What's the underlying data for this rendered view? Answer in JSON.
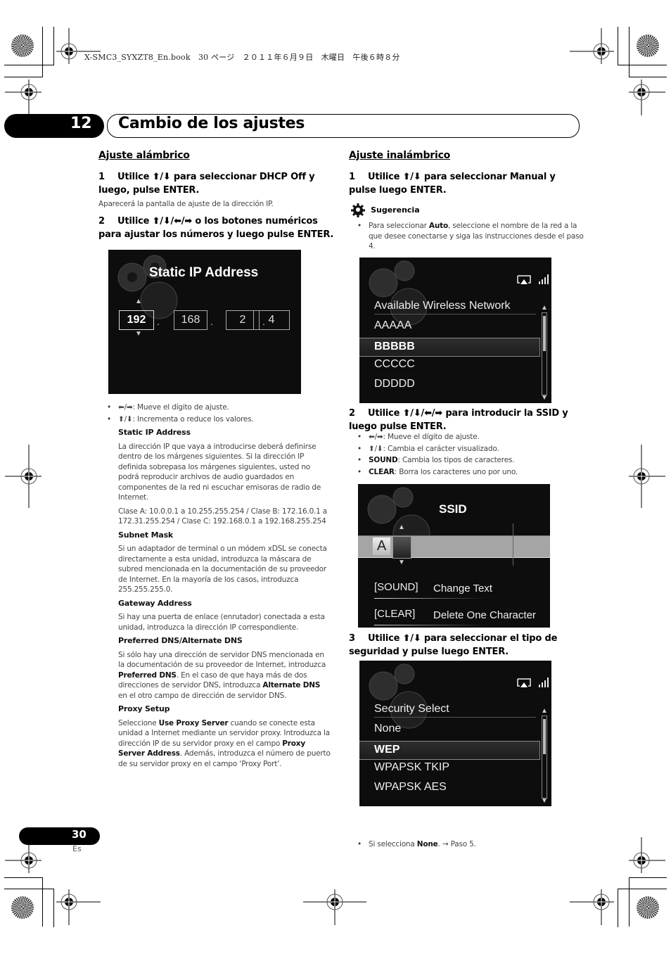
{
  "print_header": "X-SMC3_SYXZT8_En.book　30 ページ　２０１１年６月９日　木曜日　午後６時８分",
  "chapter": {
    "number": "12",
    "title": "Cambio de los ajustes"
  },
  "left": {
    "heading": "Ajuste alámbrico",
    "step1": {
      "num": "1",
      "text": "Utilice ⬆/⬇ para seleccionar DHCP Off y luego, pulse ENTER.",
      "note": "Aparecerá la pantalla de ajuste de la dirección IP."
    },
    "step2": {
      "num": "2",
      "text": "Utilice ⬆/⬇/⬅/➡ o los botones numéricos para ajustar los números y luego pulse ENTER."
    },
    "screen": {
      "title": "Static IP Address",
      "octets": [
        "192",
        "168",
        "2",
        "4"
      ],
      "selected_index": 0
    },
    "bullets": [
      "⬅/➡: Mueve el dígito de ajuste.",
      "⬆/⬇: Incrementa o reduce los valores."
    ],
    "sections": [
      {
        "title": "Static IP Address",
        "paras": [
          "La dirección IP que vaya a introducirse deberá definirse dentro de los márgenes siguientes. Si la dirección IP definida sobrepasa los márgenes siguientes, usted no podrá reproducir archivos de audio guardados en componentes de la red ni escuchar emisoras de radio de Internet.",
          "Clase A: 10.0.0.1 a 10.255.255.254 / Clase B: 172.16.0.1 a 172.31.255.254 / Clase C: 192.168.0.1 a 192.168.255.254"
        ]
      },
      {
        "title": "Subnet Mask",
        "paras": [
          "Si un adaptador de terminal o un módem xDSL se conecta directamente a esta unidad, introduzca la máscara de subred mencionada en la documentación de su proveedor de Internet. En la mayoría de los casos, introduzca 255.255.255.0."
        ]
      },
      {
        "title": "Gateway Address",
        "paras": [
          "Si hay una puerta de enlace (enrutador) conectada a esta unidad, introduzca la dirección IP correspondiente."
        ]
      },
      {
        "title": "Preferred DNS/Alternate DNS",
        "paras": [
          "Si sólo hay una dirección de servidor DNS mencionada en la documentación de su proveedor de Internet, introduzca **Preferred DNS**. En el caso de que haya más de dos direcciones de servidor DNS, introduzca **Alternate DNS** en el otro campo de dirección de servidor DNS."
        ]
      },
      {
        "title": "Proxy Setup",
        "paras": [
          "Seleccione **Use Proxy Server** cuando se conecte esta unidad a Internet mediante un servidor proxy. Introduzca la dirección IP de su servidor proxy en el campo **Proxy Server Address**. Además, introduzca el número de puerto de su servidor proxy en el campo ‘Proxy Port’."
        ]
      }
    ]
  },
  "right": {
    "heading": "Ajuste inalámbrico",
    "step1": {
      "num": "1",
      "text": "Utilice ⬆/⬇ para seleccionar Manual y pulse luego ENTER."
    },
    "tip": {
      "label": "Sugerencia",
      "text": "Para seleccionar **Auto**, seleccione el nombre de la red a la que desee conectarse y siga las instrucciones desde el paso 4."
    },
    "screen1": {
      "header": "Available Wireless Network",
      "items": [
        "AAAAA",
        "BBBBB",
        "CCCCC",
        "DDDDD"
      ],
      "selected_index": 1
    },
    "step2": {
      "num": "2",
      "text": "Utilice ⬆/⬇/⬅/➡ para introducir la SSID y luego pulse ENTER."
    },
    "step2_bullets": [
      "⬅/➡: Mueve el dígito de ajuste.",
      "⬆/⬇: Cambia el carácter visualizado.",
      "**SOUND**: Cambia los tipos de caracteres.",
      "**CLEAR**: Borra los caracteres uno por uno."
    ],
    "screen2": {
      "title": "SSID",
      "input_char": "A",
      "hints": [
        {
          "key": "[SOUND]",
          "label": "Change Text"
        },
        {
          "key": "[CLEAR]",
          "label": "Delete One Character"
        }
      ]
    },
    "step3": {
      "num": "3",
      "text": "Utilice ⬆/⬇ para seleccionar el tipo de seguridad y pulse luego ENTER."
    },
    "screen3": {
      "header": "Security Select",
      "items": [
        "None",
        "WEP",
        "WPAPSK TKIP",
        "WPAPSK AES"
      ],
      "selected_index": 1
    },
    "footnote": "Si selecciona **None**. → Paso 5."
  },
  "footer": {
    "page": "30",
    "lang": "Es"
  }
}
